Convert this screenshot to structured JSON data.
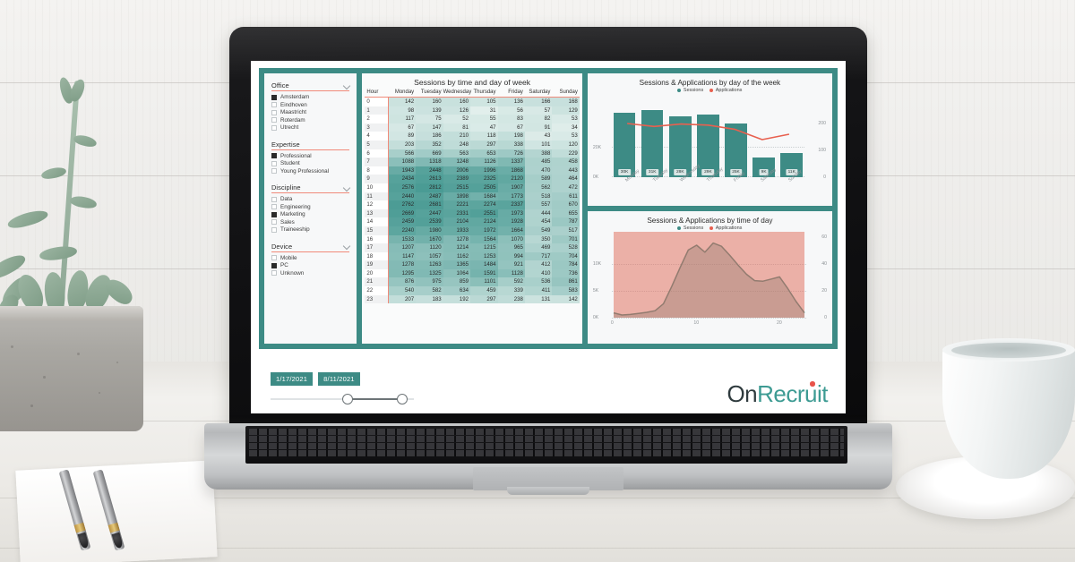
{
  "scene": {
    "description": "laptop-on-white-wood-desk-with-succulent-and-coffee"
  },
  "dashboard": {
    "filters": [
      {
        "title": "Office",
        "has_chevron": true,
        "items": [
          {
            "label": "Amsterdam",
            "checked": true
          },
          {
            "label": "Eindhoven",
            "checked": false
          },
          {
            "label": "Maastricht",
            "checked": false
          },
          {
            "label": "Roterdam",
            "checked": false
          },
          {
            "label": "Utrecht",
            "checked": false
          }
        ]
      },
      {
        "title": "Expertise",
        "has_chevron": false,
        "items": [
          {
            "label": "Professional",
            "checked": true
          },
          {
            "label": "Student",
            "checked": false
          },
          {
            "label": "Young Professional",
            "checked": false
          }
        ]
      },
      {
        "title": "Discipline",
        "has_chevron": true,
        "items": [
          {
            "label": "Data",
            "checked": false
          },
          {
            "label": "Engineering",
            "checked": false
          },
          {
            "label": "Marketing",
            "checked": true
          },
          {
            "label": "Sales",
            "checked": false
          },
          {
            "label": "Traineeship",
            "checked": false
          }
        ]
      },
      {
        "title": "Device",
        "has_chevron": true,
        "items": [
          {
            "label": "Mobile",
            "checked": false
          },
          {
            "label": "PC",
            "checked": true
          },
          {
            "label": "Unknown",
            "checked": false
          }
        ]
      }
    ],
    "date_slider": {
      "start": "1/17/2021",
      "end": "8/11/2021"
    },
    "logo": {
      "part1": "On",
      "part2": "Recruit"
    },
    "colors": {
      "teal": "#3d8b85",
      "salmon": "#f08a7a",
      "applications_red": "#e8604f",
      "logo_dark": "#2f3b3e",
      "logo_teal": "#3d9b93",
      "logo_dot": "#e8534a"
    }
  },
  "chart_data": [
    {
      "type": "heatmap",
      "id": "sessions-by-time-and-day",
      "title": "Sessions by time and day of week",
      "row_header": "Hour",
      "categories": [
        "Monday",
        "Tuesday",
        "Wednesday",
        "Thursday",
        "Friday",
        "Saturday",
        "Sunday"
      ],
      "rows": [
        {
          "hour": "0",
          "values": [
            142,
            160,
            160,
            105,
            136,
            166,
            168
          ]
        },
        {
          "hour": "1",
          "values": [
            98,
            139,
            126,
            31,
            56,
            57,
            129
          ]
        },
        {
          "hour": "2",
          "values": [
            117,
            75,
            52,
            55,
            83,
            82,
            53
          ]
        },
        {
          "hour": "3",
          "values": [
            67,
            147,
            81,
            47,
            67,
            91,
            34
          ]
        },
        {
          "hour": "4",
          "values": [
            89,
            186,
            210,
            118,
            198,
            43,
            53
          ]
        },
        {
          "hour": "5",
          "values": [
            203,
            352,
            248,
            297,
            338,
            101,
            120
          ]
        },
        {
          "hour": "6",
          "values": [
            566,
            669,
            563,
            653,
            726,
            388,
            229
          ]
        },
        {
          "hour": "7",
          "values": [
            1088,
            1318,
            1248,
            1126,
            1337,
            485,
            458
          ]
        },
        {
          "hour": "8",
          "values": [
            1943,
            2448,
            2006,
            1996,
            1868,
            470,
            443
          ]
        },
        {
          "hour": "9",
          "values": [
            2434,
            2613,
            2389,
            2325,
            2120,
            589,
            464
          ]
        },
        {
          "hour": "10",
          "values": [
            2576,
            2812,
            2515,
            2505,
            1907,
            562,
            472
          ]
        },
        {
          "hour": "11",
          "values": [
            2440,
            2487,
            1898,
            1684,
            1773,
            518,
            611
          ]
        },
        {
          "hour": "12",
          "values": [
            2762,
            2681,
            2221,
            2274,
            2337,
            557,
            670
          ]
        },
        {
          "hour": "13",
          "values": [
            2669,
            2447,
            2331,
            2551,
            1973,
            444,
            655
          ]
        },
        {
          "hour": "14",
          "values": [
            2459,
            2539,
            2104,
            2124,
            1928,
            454,
            787
          ]
        },
        {
          "hour": "15",
          "values": [
            2240,
            1980,
            1933,
            1972,
            1664,
            549,
            517
          ]
        },
        {
          "hour": "16",
          "values": [
            1533,
            1670,
            1278,
            1564,
            1070,
            350,
            701
          ]
        },
        {
          "hour": "17",
          "values": [
            1207,
            1120,
            1214,
            1215,
            965,
            469,
            528
          ]
        },
        {
          "hour": "18",
          "values": [
            1147,
            1057,
            1162,
            1253,
            994,
            717,
            704
          ]
        },
        {
          "hour": "19",
          "values": [
            1278,
            1263,
            1365,
            1484,
            921,
            412,
            784
          ]
        },
        {
          "hour": "20",
          "values": [
            1295,
            1325,
            1064,
            1591,
            1128,
            410,
            736
          ]
        },
        {
          "hour": "21",
          "values": [
            876,
            975,
            859,
            1101,
            592,
            536,
            861
          ]
        },
        {
          "hour": "22",
          "values": [
            540,
            582,
            634,
            459,
            339,
            411,
            583
          ]
        },
        {
          "hour": "23",
          "values": [
            207,
            183,
            192,
            297,
            238,
            131,
            142
          ]
        }
      ],
      "heat_min": 31,
      "heat_max": 2812
    },
    {
      "type": "bar",
      "id": "sessions-applications-by-day",
      "title": "Sessions & Applications by day of the week",
      "categories": [
        "Monday",
        "Tuesday",
        "Wednesday",
        "Thursday",
        "Friday",
        "Saturday",
        "Sunday"
      ],
      "series": [
        {
          "name": "Sessions",
          "type": "bar",
          "values": [
            30000,
            31000,
            28000,
            29000,
            25000,
            9000,
            11000
          ],
          "labels": [
            "30K",
            "31K",
            "28K",
            "29K",
            "25K",
            "9K",
            "11K"
          ],
          "axis": "left"
        },
        {
          "name": "Applications",
          "type": "line",
          "values": [
            110,
            99,
            108,
            104,
            88,
            50,
            70
          ],
          "axis": "right"
        }
      ],
      "left_axis_ticks": [
        "0K",
        "20K"
      ],
      "right_axis_ticks": [
        "0",
        "100",
        "200"
      ],
      "ylim_left": [
        0,
        36000
      ],
      "ylim_right": [
        0,
        200
      ],
      "legend": [
        "Sessions",
        "Applications"
      ],
      "legend_position": "top"
    },
    {
      "type": "area",
      "id": "sessions-applications-by-time-of-day",
      "title": "Sessions & Applications by time of day",
      "x": [
        0,
        1,
        2,
        3,
        4,
        5,
        6,
        7,
        8,
        9,
        10,
        11,
        12,
        13,
        14,
        15,
        16,
        17,
        18,
        19,
        20,
        21,
        22,
        23
      ],
      "xticks": [
        "0",
        "10",
        "20"
      ],
      "series": [
        {
          "name": "Sessions",
          "values": [
            900,
            500,
            600,
            800,
            1000,
            1300,
            2600,
            5800,
            9300,
            12600,
            13500,
            12200,
            13900,
            13300,
            11600,
            9800,
            8100,
            6900,
            6800,
            7200,
            7600,
            5400,
            3000,
            900
          ],
          "axis": "left"
        },
        {
          "name": "Applications",
          "values": [
            400,
            150,
            1300,
            600,
            1800,
            1500,
            2500,
            4600,
            7600,
            9600,
            11100,
            11100,
            8000,
            12600,
            10700,
            9200,
            8000,
            6900,
            6600,
            7000,
            6800,
            5200,
            2900,
            1300
          ],
          "axis": "right"
        }
      ],
      "left_axis_ticks": [
        "0K",
        "5K",
        "10K"
      ],
      "right_axis_ticks": [
        "0",
        "20",
        "40",
        "60"
      ],
      "ylim_left": [
        0,
        15000
      ],
      "ylim_right": [
        0,
        60
      ],
      "legend": [
        "Sessions",
        "Applications"
      ],
      "legend_position": "top"
    }
  ]
}
